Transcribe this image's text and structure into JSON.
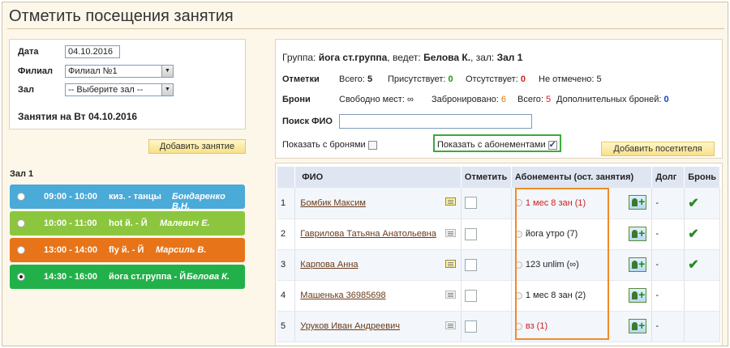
{
  "page_title": "Отметить посещения занятия",
  "filters": {
    "date_label": "Дата",
    "date_value": "04.10.2016",
    "branch_label": "Филиал",
    "branch_value": "Филиал №1",
    "hall_label": "Зал",
    "hall_value": "-- Выберите зал --",
    "sessions_heading": "Занятия на Вт 04.10.2016"
  },
  "add_session_label": "Добавить занятие",
  "hall_name": "Зал 1",
  "sessions": [
    {
      "time": "09:00 - 10:00",
      "name": "киз. - танцы",
      "teacher": "Бондаренко В.Н.",
      "color": "#4aaad8",
      "selected": false
    },
    {
      "time": "10:00 - 11:00",
      "name": "hot й. - Й",
      "teacher": "Малевич Е.",
      "color": "#8cc63f",
      "selected": false
    },
    {
      "time": "13:00 - 14:00",
      "name": "fly й. - Й",
      "teacher": "Марсиль В.",
      "color": "#e8741a",
      "selected": false
    },
    {
      "time": "14:30 - 16:00",
      "name": "йога ст.группа - Й",
      "teacher": "Белова К.",
      "color": "#22b04a",
      "selected": true
    }
  ],
  "group": {
    "prefix": "Группа:",
    "group_name": "йога ст.группа",
    "leads_label": ", ведет:",
    "teacher": "Белова К.",
    "hall_prefix": ", зал:",
    "hall": "Зал 1",
    "marks_label": "Отметки",
    "marks": {
      "total_label": "Всего:",
      "total": "5",
      "present_label": "Присутствует:",
      "present": "0",
      "absent_label": "Отсутствует:",
      "absent": "0",
      "unmarked_label": "Не отмечено:",
      "unmarked": "5"
    },
    "bookings_label": "Брони",
    "bookings": {
      "free_label": "Свободно мест:",
      "free": "∞",
      "booked_label": "Забронировано:",
      "booked": "6",
      "total_label": "Всего:",
      "total": "5",
      "extra_label": "Дополнительных броней:",
      "extra": "0"
    },
    "search_label": "Поиск ФИО",
    "search_value": "",
    "show_bookings_label": "Показать с бронями",
    "show_subscriptions_label": "Показать с абонементами",
    "add_visitor_label": "Добавить посетителя"
  },
  "table": {
    "headers": [
      "",
      "ФИО",
      "Отметить",
      "Абонементы (ост. занятия)",
      "Долг",
      "Бронь"
    ],
    "rows": [
      {
        "num": "1",
        "name": "Бомбик Максим",
        "note": "yellow",
        "subscription": "1 мес 8 зан (1)",
        "sub_color": "#d02020",
        "debt": "-",
        "booked": true
      },
      {
        "num": "2",
        "name": "Гаврилова Татьяна Анатольевна",
        "note": "gray",
        "subscription": "йога утро (7)",
        "sub_color": "#222",
        "debt": "-",
        "booked": true
      },
      {
        "num": "3",
        "name": "Карпова Анна",
        "note": "yellow",
        "subscription": "123 unlim (∞)",
        "sub_color": "#222",
        "debt": "-",
        "booked": true
      },
      {
        "num": "4",
        "name": "Машенька 36985698",
        "note": "gray",
        "subscription": "1 мес 8 зан (2)",
        "sub_color": "#222",
        "debt": "-",
        "booked": false
      },
      {
        "num": "5",
        "name": "Уруков Иван Андреевич",
        "note": "gray",
        "subscription": "вз (1)",
        "sub_color": "#d02020",
        "debt": "-",
        "booked": false
      }
    ]
  }
}
